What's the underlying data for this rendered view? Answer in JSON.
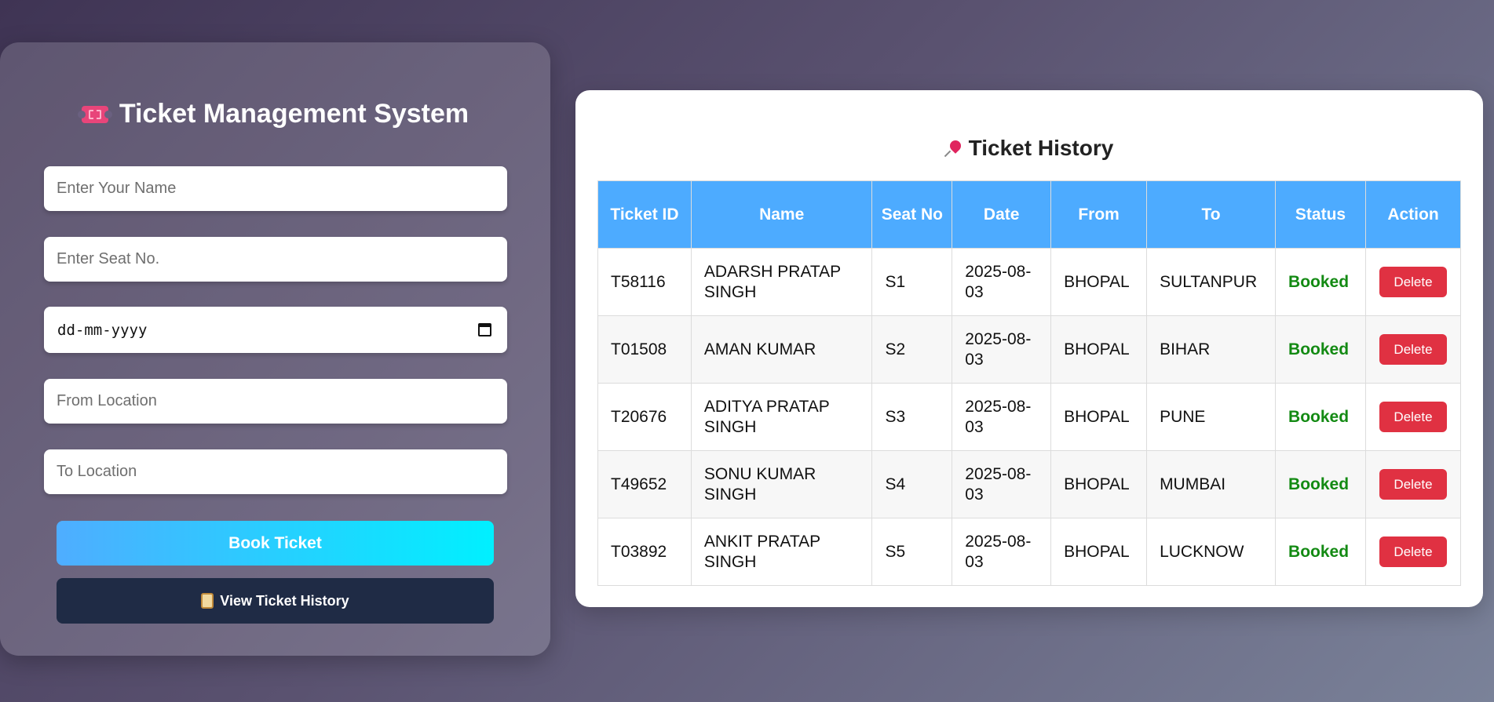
{
  "form": {
    "title": "Ticket Management System",
    "title_icon": "ticket-icon",
    "name_placeholder": "Enter Your Name",
    "seat_placeholder": "Enter Seat No.",
    "date_placeholder": "dd-mm-yyyy",
    "from_placeholder": "From Location",
    "to_placeholder": "To Location",
    "book_label": "Book Ticket",
    "history_label": "View Ticket History",
    "history_icon": "scroll-icon"
  },
  "history": {
    "title": "Ticket History",
    "title_icon": "pushpin-icon",
    "columns": [
      "Ticket ID",
      "Name",
      "Seat No",
      "Date",
      "From",
      "To",
      "Status",
      "Action"
    ],
    "rows": [
      {
        "id": "T58116",
        "name": "ADARSH PRATAP SINGH",
        "seat": "S1",
        "date": "2025-08-03",
        "from": "BHOPAL",
        "to": "SULTANPUR",
        "status": "Booked",
        "action": "Delete"
      },
      {
        "id": "T01508",
        "name": "AMAN KUMAR",
        "seat": "S2",
        "date": "2025-08-03",
        "from": "BHOPAL",
        "to": "BIHAR",
        "status": "Booked",
        "action": "Delete"
      },
      {
        "id": "T20676",
        "name": "ADITYA PRATAP SINGH",
        "seat": "S3",
        "date": "2025-08-03",
        "from": "BHOPAL",
        "to": "PUNE",
        "status": "Booked",
        "action": "Delete"
      },
      {
        "id": "T49652",
        "name": "SONU KUMAR SINGH",
        "seat": "S4",
        "date": "2025-08-03",
        "from": "BHOPAL",
        "to": "MUMBAI",
        "status": "Booked",
        "action": "Delete"
      },
      {
        "id": "T03892",
        "name": "ANKIT PRATAP SINGH",
        "seat": "S5",
        "date": "2025-08-03",
        "from": "BHOPAL",
        "to": "LUCKNOW",
        "status": "Booked",
        "action": "Delete"
      }
    ]
  },
  "colors": {
    "header_bg": "#4dabff",
    "status_booked": "#138a13",
    "delete_btn": "#e03142",
    "history_btn": "#1f2b45"
  }
}
